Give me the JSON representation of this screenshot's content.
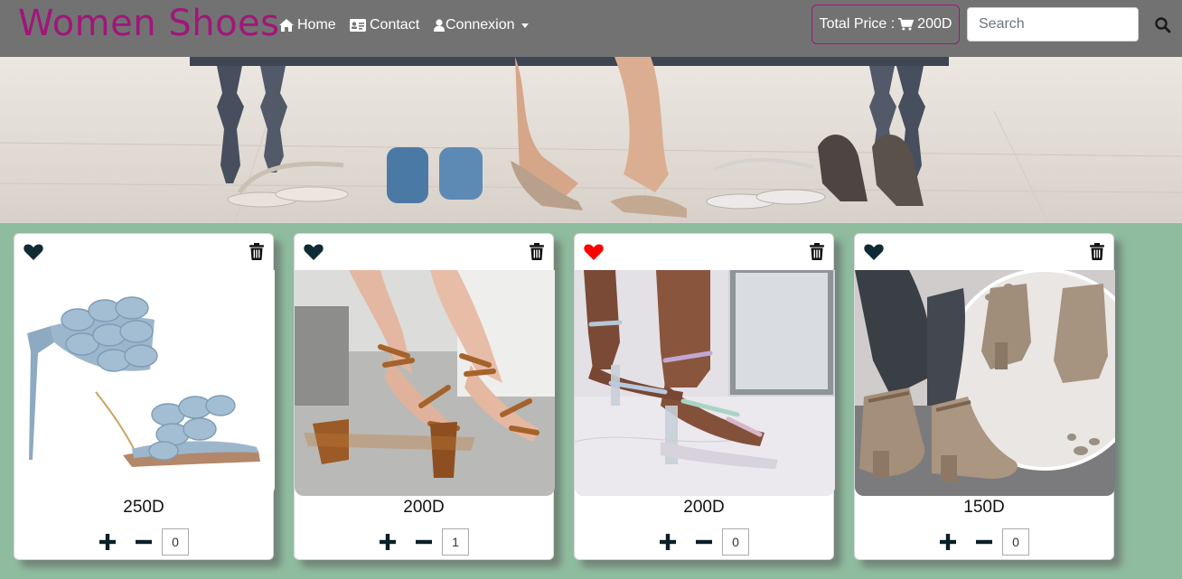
{
  "navbar": {
    "brand": "Women Shoes",
    "links": [
      {
        "label": "Home",
        "icon": "home-icon"
      },
      {
        "label": "Contact",
        "icon": "id-card-icon"
      },
      {
        "label": "Connexion",
        "icon": "user-icon"
      }
    ],
    "total_label": "Total Price :",
    "total_value": "200D",
    "search_placeholder": "Search"
  },
  "colors": {
    "brand": "#a0167a",
    "navbar_bg": "#727272",
    "page_bg": "#8fbc9f",
    "heart_default": "#0f2b36",
    "heart_liked": "#ff0000"
  },
  "products": [
    {
      "price": "250D",
      "qty": "0",
      "liked": false,
      "image": "blue woven heeled mule"
    },
    {
      "price": "200D",
      "qty": "1",
      "liked": false,
      "image": "tan lace-up block heel sandal"
    },
    {
      "price": "200D",
      "qty": "0",
      "liked": true,
      "image": "clear iridescent strap heel"
    },
    {
      "price": "150D",
      "qty": "0",
      "liked": false,
      "image": "taupe suede ankle boots"
    }
  ]
}
